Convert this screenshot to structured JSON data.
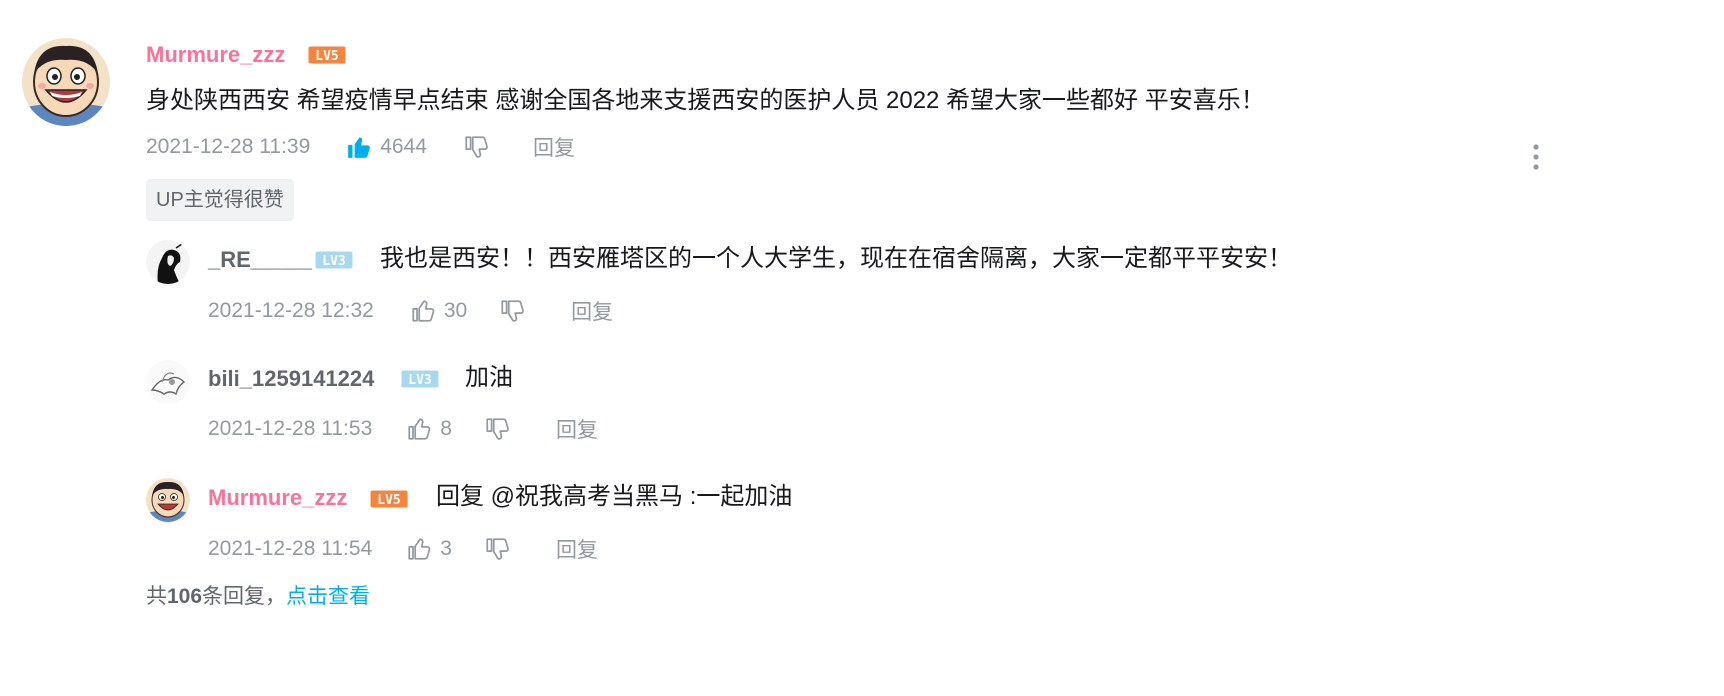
{
  "main_comment": {
    "username": "Murmure_zzz",
    "level": "LV5",
    "content": "身处陕西西安 希望疫情早点结束 感谢全国各地来支援西安的医护人员 2022 希望大家一些都好 平安喜乐！",
    "time": "2021-12-28 11:39",
    "likes": "4644",
    "reply_label": "回复",
    "up_tag": "UP主觉得很赞"
  },
  "replies": [
    {
      "username": "_RE_____",
      "level": "LV3",
      "content": "我也是西安！！西安雁塔区的一个人大学生，现在在宿舍隔离，大家一定都平平安安！",
      "time": "2021-12-28 12:32",
      "likes": "30",
      "reply_label": "回复"
    },
    {
      "username": "bili_1259141224",
      "level": "LV3",
      "content": "加油",
      "time": "2021-12-28 11:53",
      "likes": "8",
      "reply_label": "回复"
    },
    {
      "username": "Murmure_zzz",
      "level": "LV5",
      "content": "回复 @祝我高考当黑马 :一起加油",
      "time": "2021-12-28 11:54",
      "likes": "3",
      "reply_label": "回复"
    }
  ],
  "footer": {
    "prefix": "共",
    "count": "106",
    "suffix": "条回复，",
    "link": "点击查看"
  },
  "colors": {
    "pink_name": "#fb7299",
    "lv5": "#f6843d",
    "lv3": "#a8d8ee",
    "liked": "#00aeec",
    "meta": "#9499a0"
  },
  "icons": {
    "like": "thumb-up-icon",
    "dislike": "thumb-down-icon",
    "more": "more-vertical-icon"
  }
}
